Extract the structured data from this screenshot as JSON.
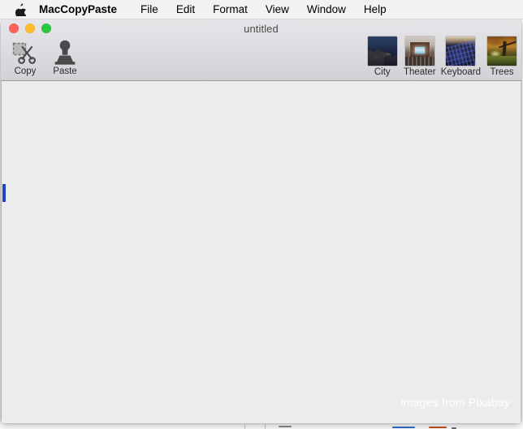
{
  "menubar": {
    "apple_icon": "apple-logo-icon",
    "app_name": "MacCopyPaste",
    "items": [
      {
        "label": "File"
      },
      {
        "label": "Edit"
      },
      {
        "label": "Format"
      },
      {
        "label": "View"
      },
      {
        "label": "Window"
      },
      {
        "label": "Help"
      }
    ]
  },
  "window": {
    "title": "untitled",
    "traffic_lights": {
      "close_color": "#ff6159",
      "minimize_color": "#ffbd2e",
      "zoom_color": "#28c840"
    }
  },
  "toolbar": {
    "tools": [
      {
        "label": "Copy",
        "icon": "scissors-icon"
      },
      {
        "label": "Paste",
        "icon": "stamp-icon"
      }
    ],
    "images": [
      {
        "label": "City",
        "icon": "city-thumbnail"
      },
      {
        "label": "Theater",
        "icon": "theater-thumbnail"
      },
      {
        "label": "Keyboard",
        "icon": "keyboard-thumbnail"
      },
      {
        "label": "Trees",
        "icon": "trees-thumbnail"
      }
    ]
  },
  "content": {
    "text": "",
    "caret_color": "#1f45c4",
    "watermark": "Images from Pixabay",
    "background_color": "#ececec"
  }
}
